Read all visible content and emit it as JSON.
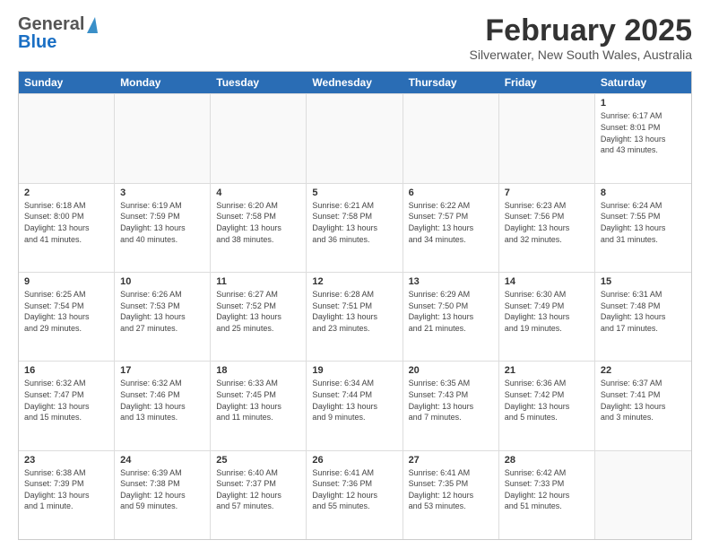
{
  "header": {
    "logo_general": "General",
    "logo_blue": "Blue",
    "month_title": "February 2025",
    "subtitle": "Silverwater, New South Wales, Australia"
  },
  "days_of_week": [
    "Sunday",
    "Monday",
    "Tuesday",
    "Wednesday",
    "Thursday",
    "Friday",
    "Saturday"
  ],
  "rows": [
    [
      {
        "day": "",
        "text": ""
      },
      {
        "day": "",
        "text": ""
      },
      {
        "day": "",
        "text": ""
      },
      {
        "day": "",
        "text": ""
      },
      {
        "day": "",
        "text": ""
      },
      {
        "day": "",
        "text": ""
      },
      {
        "day": "1",
        "text": "Sunrise: 6:17 AM\nSunset: 8:01 PM\nDaylight: 13 hours\nand 43 minutes."
      }
    ],
    [
      {
        "day": "2",
        "text": "Sunrise: 6:18 AM\nSunset: 8:00 PM\nDaylight: 13 hours\nand 41 minutes."
      },
      {
        "day": "3",
        "text": "Sunrise: 6:19 AM\nSunset: 7:59 PM\nDaylight: 13 hours\nand 40 minutes."
      },
      {
        "day": "4",
        "text": "Sunrise: 6:20 AM\nSunset: 7:58 PM\nDaylight: 13 hours\nand 38 minutes."
      },
      {
        "day": "5",
        "text": "Sunrise: 6:21 AM\nSunset: 7:58 PM\nDaylight: 13 hours\nand 36 minutes."
      },
      {
        "day": "6",
        "text": "Sunrise: 6:22 AM\nSunset: 7:57 PM\nDaylight: 13 hours\nand 34 minutes."
      },
      {
        "day": "7",
        "text": "Sunrise: 6:23 AM\nSunset: 7:56 PM\nDaylight: 13 hours\nand 32 minutes."
      },
      {
        "day": "8",
        "text": "Sunrise: 6:24 AM\nSunset: 7:55 PM\nDaylight: 13 hours\nand 31 minutes."
      }
    ],
    [
      {
        "day": "9",
        "text": "Sunrise: 6:25 AM\nSunset: 7:54 PM\nDaylight: 13 hours\nand 29 minutes."
      },
      {
        "day": "10",
        "text": "Sunrise: 6:26 AM\nSunset: 7:53 PM\nDaylight: 13 hours\nand 27 minutes."
      },
      {
        "day": "11",
        "text": "Sunrise: 6:27 AM\nSunset: 7:52 PM\nDaylight: 13 hours\nand 25 minutes."
      },
      {
        "day": "12",
        "text": "Sunrise: 6:28 AM\nSunset: 7:51 PM\nDaylight: 13 hours\nand 23 minutes."
      },
      {
        "day": "13",
        "text": "Sunrise: 6:29 AM\nSunset: 7:50 PM\nDaylight: 13 hours\nand 21 minutes."
      },
      {
        "day": "14",
        "text": "Sunrise: 6:30 AM\nSunset: 7:49 PM\nDaylight: 13 hours\nand 19 minutes."
      },
      {
        "day": "15",
        "text": "Sunrise: 6:31 AM\nSunset: 7:48 PM\nDaylight: 13 hours\nand 17 minutes."
      }
    ],
    [
      {
        "day": "16",
        "text": "Sunrise: 6:32 AM\nSunset: 7:47 PM\nDaylight: 13 hours\nand 15 minutes."
      },
      {
        "day": "17",
        "text": "Sunrise: 6:32 AM\nSunset: 7:46 PM\nDaylight: 13 hours\nand 13 minutes."
      },
      {
        "day": "18",
        "text": "Sunrise: 6:33 AM\nSunset: 7:45 PM\nDaylight: 13 hours\nand 11 minutes."
      },
      {
        "day": "19",
        "text": "Sunrise: 6:34 AM\nSunset: 7:44 PM\nDaylight: 13 hours\nand 9 minutes."
      },
      {
        "day": "20",
        "text": "Sunrise: 6:35 AM\nSunset: 7:43 PM\nDaylight: 13 hours\nand 7 minutes."
      },
      {
        "day": "21",
        "text": "Sunrise: 6:36 AM\nSunset: 7:42 PM\nDaylight: 13 hours\nand 5 minutes."
      },
      {
        "day": "22",
        "text": "Sunrise: 6:37 AM\nSunset: 7:41 PM\nDaylight: 13 hours\nand 3 minutes."
      }
    ],
    [
      {
        "day": "23",
        "text": "Sunrise: 6:38 AM\nSunset: 7:39 PM\nDaylight: 13 hours\nand 1 minute."
      },
      {
        "day": "24",
        "text": "Sunrise: 6:39 AM\nSunset: 7:38 PM\nDaylight: 12 hours\nand 59 minutes."
      },
      {
        "day": "25",
        "text": "Sunrise: 6:40 AM\nSunset: 7:37 PM\nDaylight: 12 hours\nand 57 minutes."
      },
      {
        "day": "26",
        "text": "Sunrise: 6:41 AM\nSunset: 7:36 PM\nDaylight: 12 hours\nand 55 minutes."
      },
      {
        "day": "27",
        "text": "Sunrise: 6:41 AM\nSunset: 7:35 PM\nDaylight: 12 hours\nand 53 minutes."
      },
      {
        "day": "28",
        "text": "Sunrise: 6:42 AM\nSunset: 7:33 PM\nDaylight: 12 hours\nand 51 minutes."
      },
      {
        "day": "",
        "text": ""
      }
    ]
  ]
}
